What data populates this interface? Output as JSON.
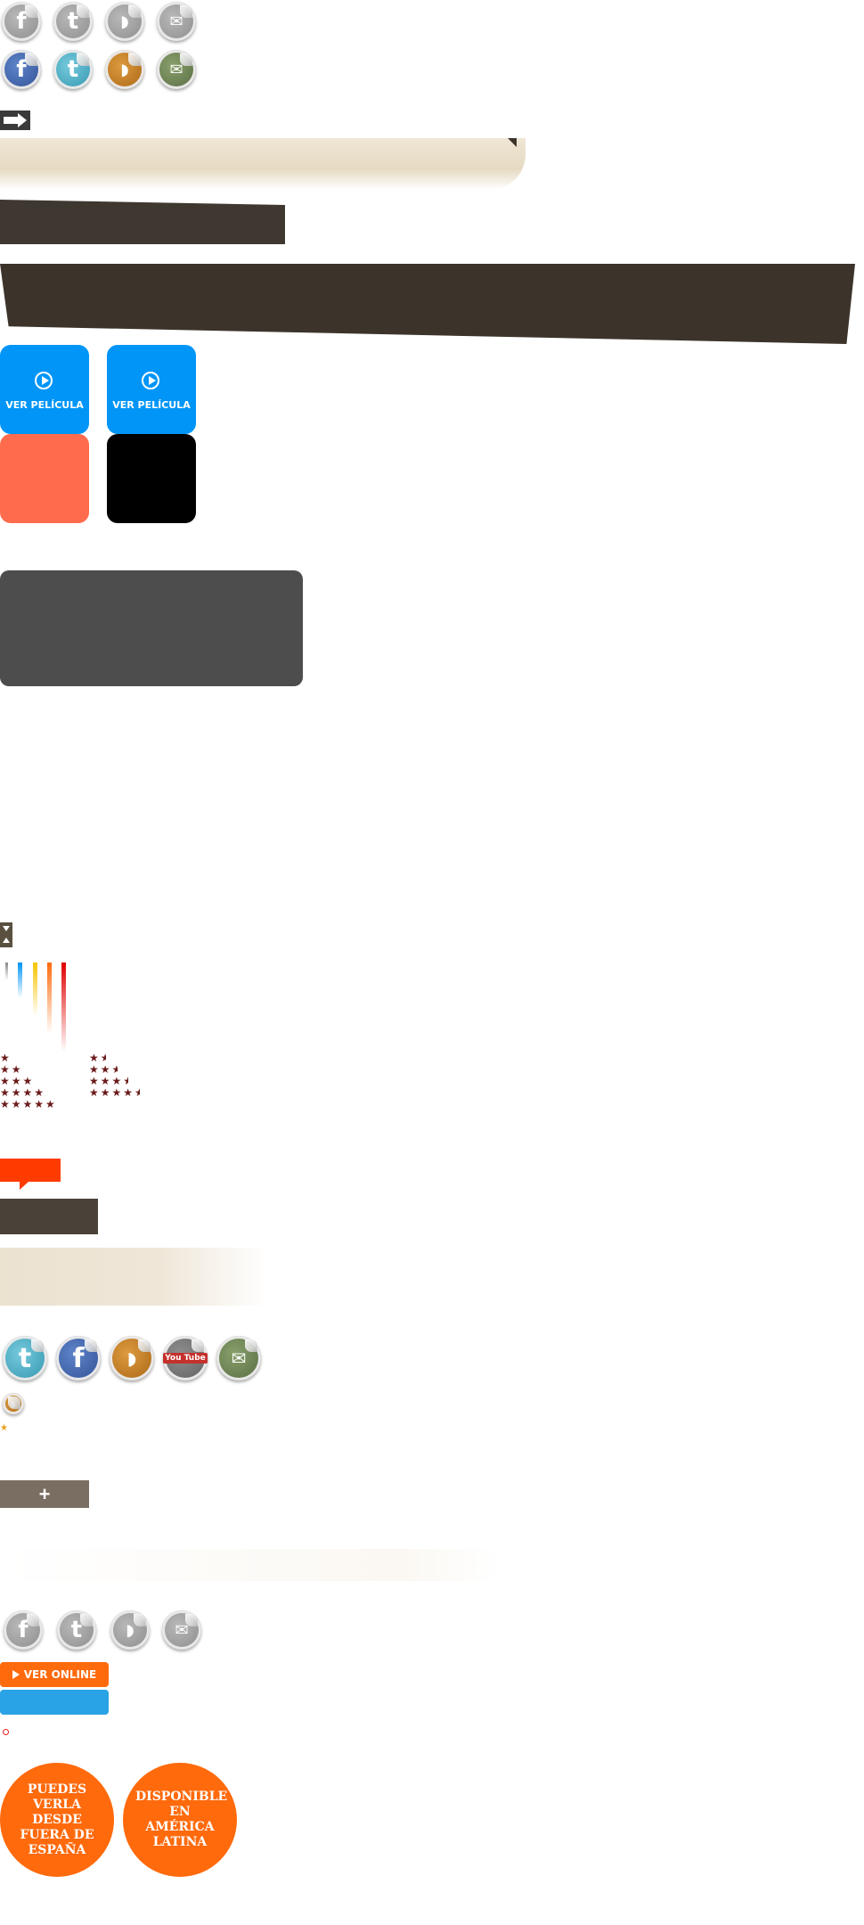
{
  "social_rows": {
    "row1": [
      "facebook-icon",
      "twitter-icon",
      "rss-icon",
      "mail-icon"
    ],
    "row2": [
      "facebook-icon",
      "twitter-icon",
      "rss-icon",
      "mail-icon"
    ],
    "row_large": [
      "twitter-icon",
      "facebook-icon",
      "rss-icon",
      "youtube-icon",
      "mail-icon"
    ],
    "row_footer": [
      "facebook-icon",
      "twitter-icon",
      "rss-icon",
      "mail-icon"
    ]
  },
  "tiles": {
    "ver_pelicula_1": "VER PELÍCULA",
    "ver_pelicula_2": "VER PELÍCULA"
  },
  "youtube_label": "You Tube",
  "buttons": {
    "ver_online": "VER ONLINE",
    "plus": "+"
  },
  "badges": {
    "fuera_espana": "PUEDES VERLA DESDE FUERA DE ESPAÑA",
    "america_latina": "DISPONIBLE EN AMÉRICA LATINA"
  },
  "ratings": {
    "left_rows": [
      1,
      2,
      3,
      4,
      5
    ],
    "right_rows": [
      1.5,
      2.5,
      3.5,
      4.5
    ]
  },
  "colors": {
    "accent_blue": "#0095f6",
    "accent_orange": "#ff6a0c",
    "dark_brown": "#3c342b",
    "star": "#6b1a1a"
  }
}
